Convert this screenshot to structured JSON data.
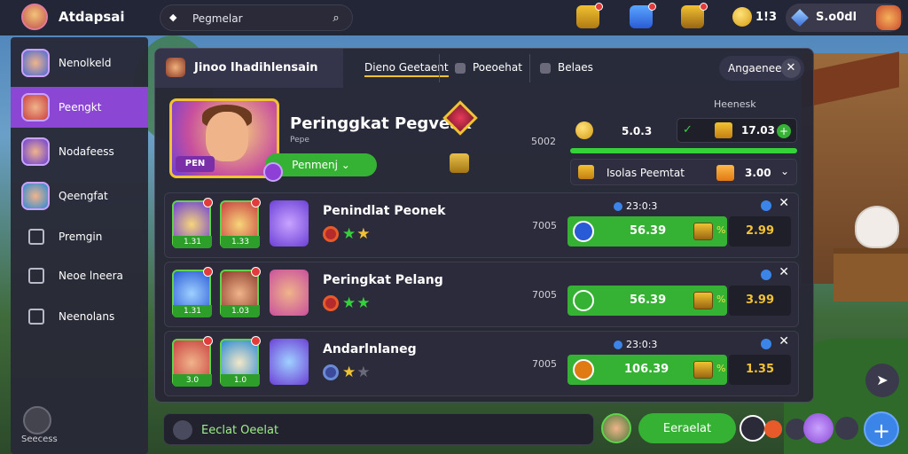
{
  "app": {
    "title": "Atdapsai"
  },
  "search": {
    "placeholder": "Pegmelar"
  },
  "topbar": {
    "coins": "1!3",
    "gems": "S.o0dl"
  },
  "sidebar": {
    "items": [
      {
        "label": "Nenolkeld"
      },
      {
        "label": "Peengkt"
      },
      {
        "label": "Nodafeess"
      },
      {
        "label": "Qeengfat"
      },
      {
        "label": "Premgin"
      },
      {
        "label": "Neoe lneera"
      },
      {
        "label": "Neenolans"
      }
    ],
    "footer_label": "Seecess"
  },
  "panel": {
    "title_tab": "Jinoo Ihadihlensain",
    "tabs": [
      {
        "label": "Dieno Geetaent"
      },
      {
        "label": "Poeoehat"
      },
      {
        "label": "Belaes"
      }
    ],
    "close_label": "Angaenee"
  },
  "hero": {
    "title": "Peringgkat Pegveak",
    "subtitle": "Pepe",
    "badge": "PEN",
    "button": "Penmenj",
    "pct": "5002"
  },
  "rewards": {
    "label": "Heenesk",
    "value1": "5.0.3",
    "value2": "17.03",
    "row_label": "Isolas Peemtat",
    "row_value": "3.00"
  },
  "rows": [
    {
      "title": "Penindlat Peonek",
      "pct": "7005",
      "time": "23:0:3",
      "bar_value": "56.39",
      "tag": "%",
      "price": "2.99",
      "levels": [
        "1.31",
        "1.33"
      ]
    },
    {
      "title": "Peringkat Pelang",
      "pct": "7005",
      "time": "",
      "bar_value": "56.39",
      "tag": "%",
      "price": "3.99",
      "levels": [
        "1.31",
        "1.03"
      ]
    },
    {
      "title": "Andarlnlaneg",
      "pct": "7005",
      "time": "23:0:3",
      "bar_value": "106.39",
      "tag": "%",
      "price": "1.35",
      "levels": [
        "3.0",
        "1.0"
      ]
    }
  ],
  "bottom": {
    "chat_placeholder": "Eeclat Oeelat",
    "send_label": "Eeraelat"
  }
}
